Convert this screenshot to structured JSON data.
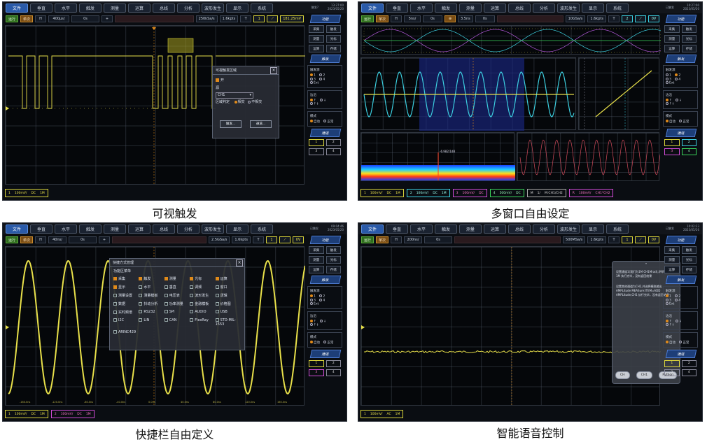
{
  "captions": [
    "可视触发",
    "多窗口自由设定",
    "快捷栏自由定义",
    "智能语音控制"
  ],
  "menu": [
    "文件",
    "垂直",
    "水平",
    "触发",
    "测量",
    "运算",
    "总线",
    "分析",
    "波形发生",
    "显示",
    "系统"
  ],
  "toolbar": {
    "run": "运行",
    "single": "单次",
    "h": "H",
    "t": "T"
  },
  "sidebar": {
    "func_head": "功能",
    "func_buttons": [
      "采集",
      "触发",
      "测量",
      "光标",
      "运算",
      "存储"
    ],
    "trig_head": "触发",
    "trig_source_title": "触发源",
    "trig_sources": [
      "1",
      "2",
      "3",
      "4",
      "Ext"
    ],
    "edge_title": "边沿",
    "edge_opts": [
      "↑",
      "↓",
      "↑↓"
    ],
    "mode_title": "模式",
    "mode_opts": [
      "自动",
      "正常"
    ],
    "chan_head": "通道",
    "channels": [
      "1",
      "2",
      "3",
      "4"
    ]
  },
  "panel1": {
    "timebase": "400µs/",
    "delay": "0s",
    "rate": "250kSa/s",
    "mem": "1.6kpts",
    "trig_ch": "1",
    "level": "181.25mV",
    "brand": "触发?",
    "clock": "13:27:00 2023/05/20",
    "ch_tag": {
      "ch": "1",
      "scale": "100mV/",
      "coupling": "DC",
      "bw": "1M"
    },
    "dialog": {
      "title": "可视触发区域",
      "enable": "开",
      "source_label": "源",
      "source_value": "CH1",
      "judge_label": "区域判定",
      "opt_intersect": "相交",
      "opt_not": "不相交",
      "btn_trigger": "触发...",
      "btn_channel": "通道..."
    }
  },
  "panel2": {
    "timebase": "5ns/",
    "delay": "0s",
    "zoom": "3.5ns",
    "zoom_delay": "0s",
    "rate": "10GSa/s",
    "mem": "1.6kpts",
    "trig_ch": "2",
    "level": "0V",
    "brand": "已触发",
    "clock": "10:27:00 2023/05/20",
    "marker": "-6.982/1dB",
    "ch_tags": [
      {
        "ch": "1",
        "scale": "100mV/",
        "coupling": "DC",
        "bw": "1M"
      },
      {
        "ch": "2",
        "scale": "100mV/",
        "coupling": "DC",
        "bw": "1M"
      },
      {
        "ch": "3",
        "scale": "100mV/",
        "coupling": "DC",
        "bw": "1M"
      },
      {
        "ch": "4",
        "scale": "500mV/",
        "coupling": "DC",
        "bw": "1M"
      },
      {
        "ch": "M",
        "scale": "1/",
        "coupling": "M:CH1/CH2",
        "bw": ""
      },
      {
        "ch": "R",
        "scale": "100mV/",
        "coupling": "CH1*CH2",
        "bw": ""
      }
    ]
  },
  "panel3": {
    "timebase": "40ns/",
    "delay": "0s",
    "rate": "2.5GSa/s",
    "mem": "1.6kpts",
    "trig_ch": "1",
    "level": "0V",
    "brand": "已触发",
    "clock": "09:04:46 2023/05/20",
    "ch_tags": [
      {
        "ch": "1",
        "scale": "100mV/",
        "coupling": "DC",
        "bw": "1M"
      },
      {
        "ch": "2",
        "scale": "100mV/",
        "coupling": "DC",
        "bw": "1M"
      }
    ],
    "dialog": {
      "title": "快捷方式管理",
      "subtitle": "功能区菜单",
      "items": [
        {
          "label": "采集",
          "on": true
        },
        {
          "label": "触发",
          "on": true
        },
        {
          "label": "测量",
          "on": true
        },
        {
          "label": "光标",
          "on": true
        },
        {
          "label": "运算",
          "on": true
        },
        {
          "label": "显示",
          "on": true
        },
        {
          "label": "水平",
          "on": false
        },
        {
          "label": "垂直",
          "on": false
        },
        {
          "label": "调频",
          "on": false
        },
        {
          "label": "窗口",
          "on": false
        },
        {
          "label": "测量设置",
          "on": false
        },
        {
          "label": "测量模板",
          "on": false
        },
        {
          "label": "电压表",
          "on": false
        },
        {
          "label": "波形发生",
          "on": false
        },
        {
          "label": "逻辑",
          "on": false
        },
        {
          "label": "数据",
          "on": false
        },
        {
          "label": "抖动分析",
          "on": false
        },
        {
          "label": "功率测量",
          "on": false
        },
        {
          "label": "金融模板",
          "on": false
        },
        {
          "label": "价格图",
          "on": false
        },
        {
          "label": "实时频谱",
          "on": false
        },
        {
          "label": "RS232",
          "on": false
        },
        {
          "label": "SPI",
          "on": false
        },
        {
          "label": "AUDIO",
          "on": false
        },
        {
          "label": "USB",
          "on": false
        },
        {
          "label": "I2C",
          "on": false
        },
        {
          "label": "LIN",
          "on": false
        },
        {
          "label": "CAN",
          "on": false
        },
        {
          "label": "FlexRay",
          "on": false
        },
        {
          "label": "STD-MIL-1553",
          "on": false
        },
        {
          "label": "ARINC429",
          "on": false
        }
      ]
    },
    "scale_ticks": [
      "-160.0ns",
      "-120.0ns",
      "-80.0ns",
      "-40.0ns",
      "0.0ns",
      "40.0ns",
      "80.0ns",
      "120.0ns",
      "160.0ns"
    ]
  },
  "panel4": {
    "timebase": "200ns/",
    "delay": "0s",
    "rate": "500MSa/s",
    "mem": "1.6kpts",
    "trig_ch": "1",
    "level": "0V",
    "brand": "已触发",
    "clock": "10:02:23 2023/05/26",
    "ch_tag": {
      "ch": "1",
      "scale": "100mV/",
      "coupling": "AC",
      "bw": "1M"
    },
    "voice": {
      "text1": "设置通道1(我们为1M CH1Mrad),(M)Pedance 1M 执行完毕，没有返回结果",
      "text2": "设置其他通道为CH2,并选择模拟输出 AMPLitude MEASure:ITEM=ADD AMPLitude,CH1 执行完毕，没有返回结果",
      "btn_ok": "CH",
      "btn_ch": "CH1",
      "btn_py": "Python"
    }
  },
  "colors": {
    "ch1": "#e8e04a",
    "ch2": "#3ccfe0",
    "ch3": "#d04ad6",
    "ch4": "#3ad65a",
    "accent": "#2a5aa8",
    "trigger": "#e08a1a"
  }
}
